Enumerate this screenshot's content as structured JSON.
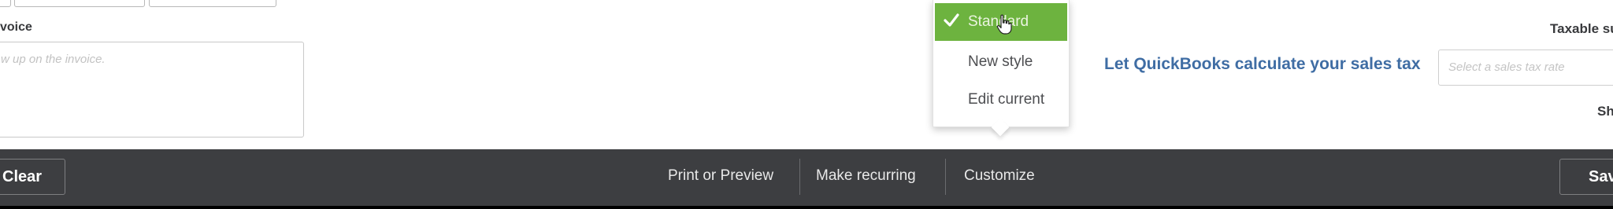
{
  "memo": {
    "label": "voice",
    "placeholder": "w up on the invoice."
  },
  "style_menu": {
    "items": [
      {
        "label": "Standard",
        "selected": true
      },
      {
        "label": "New style",
        "selected": false
      },
      {
        "label": "Edit current",
        "selected": false
      }
    ],
    "selected_color": "#6db33f"
  },
  "sales_tax": {
    "link_text": "Let QuickBooks calculate your sales tax",
    "select_placeholder": "Select a sales tax rate",
    "link_color": "#3f6da4"
  },
  "summary": {
    "taxable_label": "Taxable su",
    "sh_label": "Sh"
  },
  "footer": {
    "clear_label": "Clear",
    "print_label": "Print or Preview",
    "recurring_label": "Make recurring",
    "customize_label": "Customize",
    "save_label": "Sav",
    "background": "#3d3e41"
  }
}
